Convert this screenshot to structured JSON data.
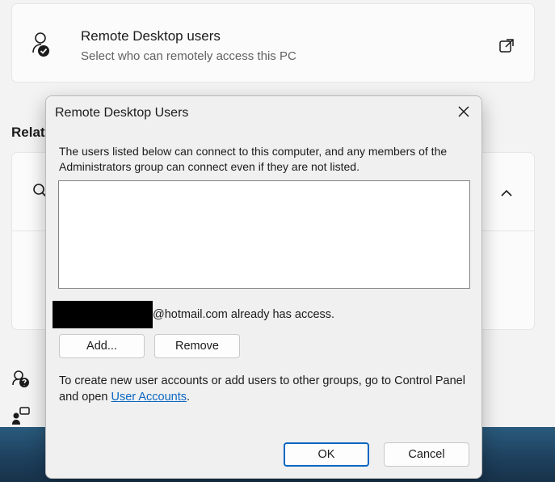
{
  "settings": {
    "remote_users": {
      "title": "Remote Desktop users",
      "subtitle": "Select who can remotely access this PC",
      "icon": "user-check-icon",
      "action_icon": "open-external-icon"
    },
    "related_heading": "Relat",
    "card_icon": "search-person-icon",
    "chevron_icon": "chevron-up-icon"
  },
  "dialog": {
    "title": "Remote Desktop Users",
    "close_icon": "close-icon",
    "description": "The users listed below can connect to this computer, and any members of the Administrators group can connect even if they are not listed.",
    "users": [],
    "access_message": "@hotmail.com already has access.",
    "buttons": {
      "add": "Add...",
      "remove": "Remove",
      "ok": "OK",
      "cancel": "Cancel"
    },
    "hint_prefix": "To create new user accounts or add users to other groups, go to Control Panel and open ",
    "hint_link": "User Accounts",
    "hint_suffix": "."
  },
  "colors": {
    "accent": "#0a66c2",
    "dialog_bg": "#f0f0f0",
    "page_bg": "#f3f3f3"
  }
}
